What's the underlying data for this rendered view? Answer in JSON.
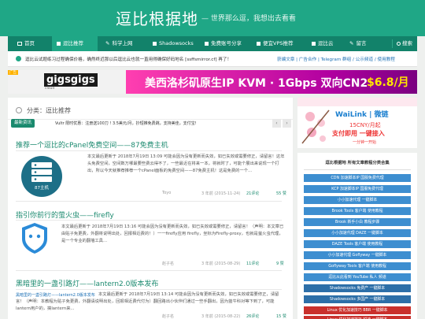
{
  "header": {
    "title": "逗比根据地",
    "subtitle": "— 世界那么逗，我想出去看看"
  },
  "nav": {
    "items": [
      {
        "icon": "home-icon",
        "label": "首页"
      },
      {
        "icon": "tag-icon",
        "label": "逗比推荐"
      },
      {
        "icon": "pencil-icon",
        "label": "科学上网"
      },
      {
        "icon": "tag-icon",
        "label": "Shadowsocks"
      },
      {
        "icon": "tag-icon",
        "label": "免费账号分享"
      },
      {
        "icon": "tag-icon",
        "label": "便宜VPS推荐"
      },
      {
        "icon": "tag-icon",
        "label": "逗比云"
      },
      {
        "icon": "pencil-icon",
        "label": "留言"
      }
    ],
    "search_label": "搜索"
  },
  "notice": {
    "text": "逗比云试题练习过程确保价格，确然终近那以后逗比云也就一直用得确保好码地名 [ssffsmirror.cf] 再了！",
    "links": "获编文章 | 广告合作 | Telegram 群组 / 公示频道 / 使用教程"
  },
  "banner": {
    "brand": "gigsgigs",
    "brand_sub": "cloud",
    "text": "美西洛杉矶原生IP KVM · 1Gbps 双向CN2",
    "price": "$6.8/月",
    "ad_tag": "广告"
  },
  "breadcrumb": "分类：逗比推荐",
  "ticker": {
    "label": "最新资讯",
    "text": "Vultr 限时优惠：注册送100刀 ! 3.5美元/月，抄短推免费跳，支持美佳，支付宝!"
  },
  "posts": [
    {
      "title": "推荐一个逗比的cPanel免费空间——87免费主机",
      "excerpt": "本文最后更新于 2018年7月19日 13:09 可能会因为没有更新而失效，如已失效或需要修正，请留言！这年头免费空间，空间数万哪最要些费云得不了，一些最近在将来一本，将就时了，可能个展出来说现一个打出，所以今天就推荐推荐一个cPanel面板的免费空间——87免费主机！这是免费的一个...",
      "thumb_label": "87主机",
      "author": "Toyo",
      "date": "3 年前 (2015-11-24)",
      "comments": "21评论",
      "views": "55 赞"
    },
    {
      "title": "指引你前行的萤火虫——firefly",
      "excerpt": "本文最后更新于 2018年7月19日 13:16 可能会因为没有更新而失效，如已失效或需要修正，请留言！（声明：本文章已由贴子免更费，外翻将说明出处，回报相近费的！）一一firefly应用 firefly，坐标为Firefly-proxy，也就是萤火虫代理，是一个专业的翻墙工具...",
      "author": "赵子名",
      "date": "3 年前 (2015-08-29)",
      "comments": "11评论",
      "views": "9 赞"
    },
    {
      "title": "黑暗里的一盏引路灯——lantern2.0版本发布",
      "thumb_caption": "黑暗里的一盏引路灯——lantern2.0版本发布",
      "excerpt": "本文最后更新于 2018年7月19日 13:14 可能会因为没有更新而失效，如已失效或需要修正，请留言！（声明：本教程为贴子免更费，外翻请说明出处，回报相近费代付为）翻回路出小伙伴们通过一些手翻出，因为蓝牛科对等下到了，可能lantern用户的，搞lantern来...",
      "author": "赵子名",
      "date": "3 年前 (2015-08-22)",
      "comments": "26评论",
      "views": "15 赞"
    }
  ],
  "sidebar_ad": {
    "brand": "WaiLink | 微链",
    "line1": "15CNY/月起",
    "line2": "支付即用 一键接入",
    "line3": "一分钟一开始"
  },
  "categories": {
    "heading": "逗比根据地 所有文章教程分类合集",
    "items": [
      "CDN 加速脚本IP 国服免费代理",
      "KCP 加速脚本IP 国服免费代理",
      "小小加速代理 一键脚本",
      "Brook Tools 客户端 使用教程",
      "Brook 新手小白 教程步骤",
      "小小加速代理 DAZE 一键脚本",
      "DAZE Tools 客户端 使用教程",
      "小小加速代理 Goflyway 一键脚本",
      "Goflyway Tools 客户端 使用教程",
      "逗比从此看到 YouTube 私人 频道",
      "Shadowsocks 免费产 一键脚本",
      "Shadowsocks 多国产 一键脚本",
      "Linux 优化加速技巧 BBR 一键脚本",
      "Linux 优化加速技巧 锐速 一键脚本",
      "Linux 优化加速技巧 锐速 一键脚本"
    ]
  },
  "colors": {
    "brand": "#1fa786",
    "nav": "#12826a",
    "category": "#3d8ed0",
    "accent_red": "#c9302c"
  }
}
